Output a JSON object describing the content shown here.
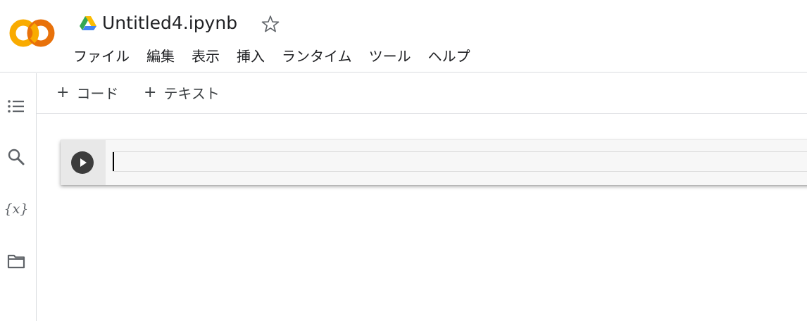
{
  "header": {
    "doc_title": "Untitled4.ipynb",
    "logo_text": "CO",
    "menu": [
      "ファイル",
      "編集",
      "表示",
      "挿入",
      "ランタイム",
      "ツール",
      "ヘルプ"
    ]
  },
  "toolbar": {
    "add_code_label": "コード",
    "add_text_label": "テキスト",
    "plus": "+"
  },
  "sidebar": {
    "icons": [
      "table-of-contents-icon",
      "search-icon",
      "variables-icon",
      "folder-icon"
    ],
    "variables_label": "{x}"
  },
  "cell": {
    "code": ""
  },
  "colors": {
    "logo_orange": "#e8710a",
    "logo_yellow": "#f9ab00",
    "border": "#dadce0"
  }
}
